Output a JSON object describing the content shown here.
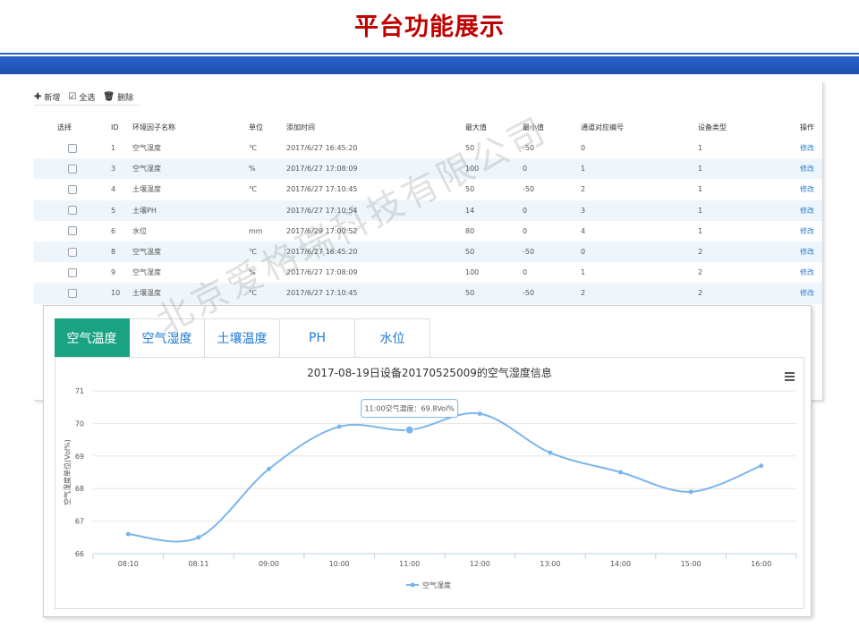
{
  "slide": {
    "title": "平台功能展示"
  },
  "toolbar": {
    "add_label": "新增",
    "select_all_label": "全选",
    "delete_label": "删除"
  },
  "table": {
    "headers": [
      "选择",
      "ID",
      "环境因子名称",
      "单位",
      "添加时间",
      "最大值",
      "最小值",
      "通道对应编号",
      "设备类型",
      "操作"
    ],
    "rows": [
      {
        "id": "1",
        "name": "空气温度",
        "unit": "℃",
        "time": "2017/6/27 16:45:20",
        "max": "50",
        "min": "-50",
        "channel": "0",
        "device": "1",
        "action": "修改"
      },
      {
        "id": "3",
        "name": "空气湿度",
        "unit": "%",
        "time": "2017/6/27 17:08:09",
        "max": "100",
        "min": "0",
        "channel": "1",
        "device": "1",
        "action": "修改"
      },
      {
        "id": "4",
        "name": "土壤温度",
        "unit": "℃",
        "time": "2017/6/27 17:10:45",
        "max": "50",
        "min": "-50",
        "channel": "2",
        "device": "1",
        "action": "修改"
      },
      {
        "id": "5",
        "name": "土壤PH",
        "unit": "",
        "time": "2017/6/27 17:10:54",
        "max": "14",
        "min": "0",
        "channel": "3",
        "device": "1",
        "action": "修改"
      },
      {
        "id": "6",
        "name": "水位",
        "unit": "mm",
        "time": "2017/6/29 17:00:52",
        "max": "80",
        "min": "0",
        "channel": "4",
        "device": "1",
        "action": "修改"
      },
      {
        "id": "8",
        "name": "空气温度",
        "unit": "℃",
        "time": "2017/6/27 16:45:20",
        "max": "50",
        "min": "-50",
        "channel": "0",
        "device": "2",
        "action": "修改"
      },
      {
        "id": "9",
        "name": "空气湿度",
        "unit": "%",
        "time": "2017/6/27 17:08:09",
        "max": "100",
        "min": "0",
        "channel": "1",
        "device": "2",
        "action": "修改"
      },
      {
        "id": "10",
        "name": "土壤温度",
        "unit": "℃",
        "time": "2017/6/27 17:10:45",
        "max": "50",
        "min": "-50",
        "channel": "2",
        "device": "2",
        "action": "修改"
      }
    ]
  },
  "tabs": [
    {
      "label": "空气温度",
      "active": true
    },
    {
      "label": "空气湿度",
      "active": false
    },
    {
      "label": "土壤温度",
      "active": false
    },
    {
      "label": "PH",
      "active": false
    },
    {
      "label": "水位",
      "active": false
    }
  ],
  "colors": {
    "title_red": "#c00000",
    "band_blue": "#1e4fb2",
    "tab_green": "#1aa383",
    "line_blue": "#7cb5ec",
    "link_blue": "#2f7fd1"
  },
  "chart_data": {
    "type": "line",
    "title": "2017-08-19日设备20170525009的空气湿度信息",
    "ylabel": "空气湿度单位(Vol%)",
    "xlabel": "",
    "categories": [
      "08:10",
      "08:11",
      "09:00",
      "10:00",
      "11:00",
      "12:00",
      "13:00",
      "14:00",
      "15:00",
      "16:00"
    ],
    "series": [
      {
        "name": "空气湿度",
        "values": [
          66.6,
          66.5,
          68.6,
          69.9,
          69.8,
          70.3,
          69.1,
          68.5,
          67.9,
          68.7
        ]
      }
    ],
    "ylim": [
      66,
      71
    ],
    "yticks": [
      66,
      67,
      68,
      69,
      70,
      71
    ],
    "grid": true,
    "legend_position": "bottom",
    "tooltip": {
      "label": "11:00空气湿度：69.8Vol%",
      "index": 4
    }
  },
  "watermark": "北京爱格瑞科技有限公司"
}
